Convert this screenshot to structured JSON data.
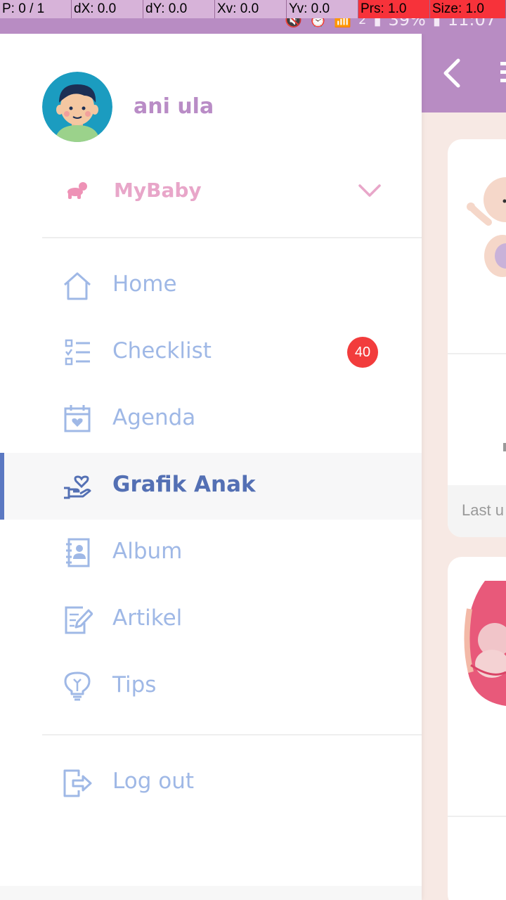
{
  "debug": {
    "pointer": "P: 0 / 1",
    "dx": "dX: 0.0",
    "dy": "dY: 0.0",
    "xv": "Xv: 0.0",
    "yv": "Yv: 0.0",
    "prs": "Prs: 1.0",
    "size": "Size: 1.0"
  },
  "status_bar": {
    "sim_badge": "2",
    "battery": "39%",
    "time": "11:07"
  },
  "user": {
    "name": "ani ula",
    "avatar_icon": "user-avatar"
  },
  "baby_selector": {
    "label": "MyBaby",
    "icon": "crawling-baby-icon",
    "expand_icon": "chevron-down-icon"
  },
  "nav": {
    "items": [
      {
        "label": "Home",
        "icon": "home-icon",
        "active": false
      },
      {
        "label": "Checklist",
        "icon": "checklist-icon",
        "active": false,
        "badge": "40"
      },
      {
        "label": "Agenda",
        "icon": "calendar-heart-icon",
        "active": false
      },
      {
        "label": "Grafik Anak",
        "icon": "hand-heart-icon",
        "active": true
      },
      {
        "label": "Album",
        "icon": "album-icon",
        "active": false
      },
      {
        "label": "Artikel",
        "icon": "article-edit-icon",
        "active": false
      },
      {
        "label": "Tips",
        "icon": "lightbulb-icon",
        "active": false
      }
    ],
    "logout": {
      "label": "Log out",
      "icon": "logout-icon"
    }
  },
  "background": {
    "card_footer_text": "Last u"
  },
  "colors": {
    "accent": "#b88cc3",
    "nav_text": "#9fb8e6",
    "nav_active": "#5470b4",
    "baby_pink": "#e8a6c9",
    "badge_red": "#f23c3c",
    "content_bg": "#f7e9e4"
  }
}
